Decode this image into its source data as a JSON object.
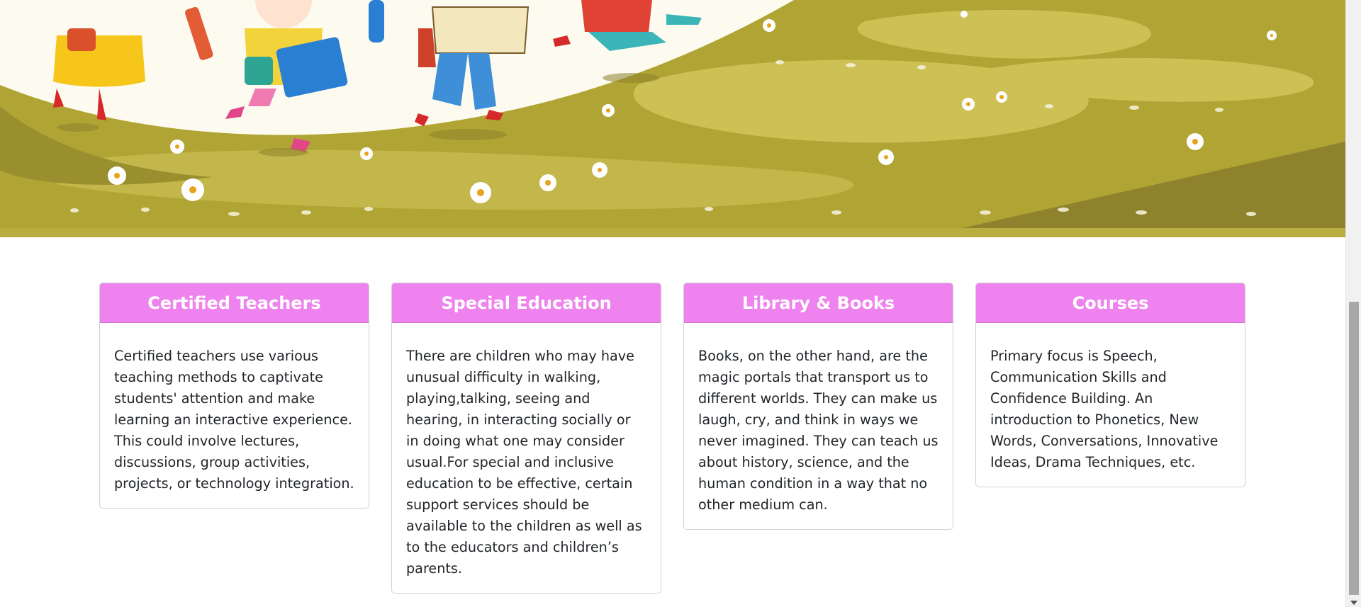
{
  "hero": {
    "image_name": "kids-jumping-on-meadow-illustration",
    "colors": {
      "meadow": "#b0a534",
      "meadow_light": "#cdc055",
      "meadow_dark": "#8e822c",
      "sky": "#fdfbf0"
    }
  },
  "features": {
    "header_color": "#ee82ee",
    "cards": [
      {
        "title": "Certified Teachers",
        "text": "Certified teachers use various teaching methods to captivate students' attention and make learning an interactive experience. This could involve lectures, discussions, group activities, projects, or technology integration."
      },
      {
        "title": "Special Education",
        "text": "There are children who may have unusual difficulty in walking, playing,talking, seeing and hearing, in interacting socially or in doing what one may consider usual.For special and inclusive education to be effective, certain support services should be available to the children as well as to the educators and children’s parents."
      },
      {
        "title": "Library & Books",
        "text": "Books, on the other hand, are the magic portals that transport us to different worlds. They can make us laugh, cry, and think in ways we never imagined. They can teach us about history, science, and the human condition in a way that no other medium can."
      },
      {
        "title": "Courses",
        "text": "Primary focus is Speech, Communication Skills and Confidence Building. An introduction to Phonetics, New Words, Conversations, Innovative Ideas, Drama Techniques, etc."
      }
    ]
  }
}
